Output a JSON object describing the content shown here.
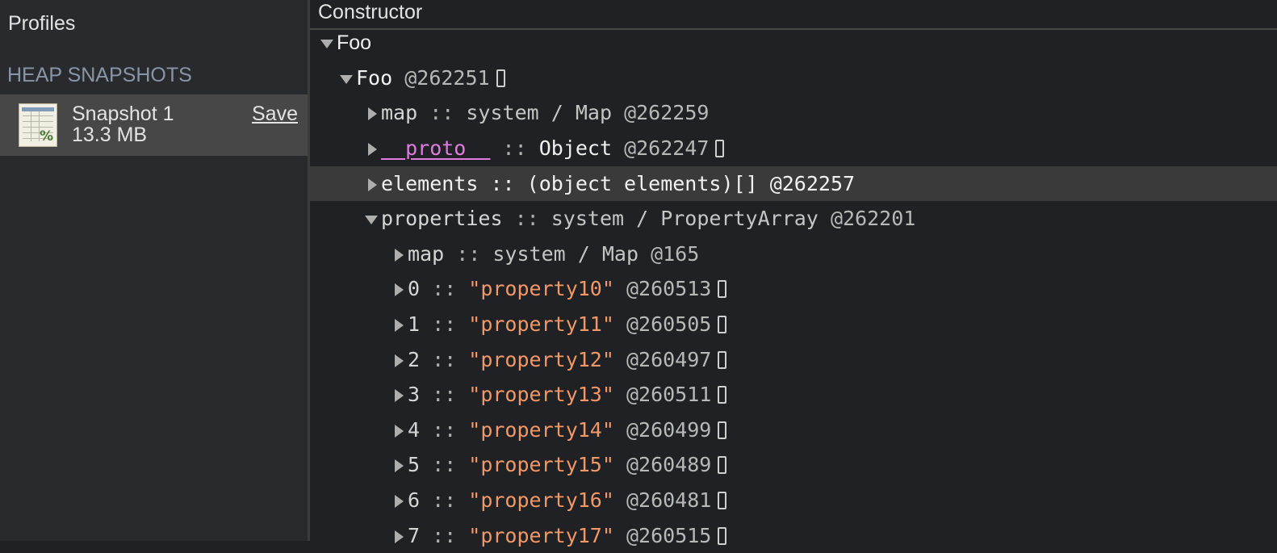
{
  "sidebar": {
    "title": "Profiles",
    "section_label": "HEAP SNAPSHOTS",
    "snapshot": {
      "name": "Snapshot 1",
      "size": "13.3 MB",
      "save_label": "Save",
      "icon": "spreadsheet-percent-icon"
    }
  },
  "main": {
    "column_header": "Constructor",
    "constructor_group": "Foo",
    "tree": {
      "root": {
        "name": "Foo",
        "id": "@262251"
      },
      "children": [
        {
          "name": "map",
          "sep": " :: ",
          "type": "system / Map",
          "id": "@262259"
        },
        {
          "name": "__proto__",
          "sep": " :: ",
          "type": "Object",
          "id": "@262247"
        },
        {
          "name": "elements",
          "sep": " :: ",
          "type": "(object elements)[]",
          "id": "@262257"
        },
        {
          "name": "properties",
          "sep": " :: ",
          "type": "system / PropertyArray",
          "id": "@262201"
        }
      ],
      "property_children": [
        {
          "name": "map",
          "sep": " :: ",
          "type": "system / Map",
          "id": "@165"
        },
        {
          "name": "0",
          "sep": " :: ",
          "value": "\"property10\"",
          "id": "@260513"
        },
        {
          "name": "1",
          "sep": " :: ",
          "value": "\"property11\"",
          "id": "@260505"
        },
        {
          "name": "2",
          "sep": " :: ",
          "value": "\"property12\"",
          "id": "@260497"
        },
        {
          "name": "3",
          "sep": " :: ",
          "value": "\"property13\"",
          "id": "@260511"
        },
        {
          "name": "4",
          "sep": " :: ",
          "value": "\"property14\"",
          "id": "@260499"
        },
        {
          "name": "5",
          "sep": " :: ",
          "value": "\"property15\"",
          "id": "@260489"
        },
        {
          "name": "6",
          "sep": " :: ",
          "value": "\"property16\"",
          "id": "@260481"
        },
        {
          "name": "7",
          "sep": " :: ",
          "value": "\"property17\"",
          "id": "@260515"
        }
      ]
    }
  },
  "colors": {
    "background": "#202124",
    "sidebar": "#292a2d",
    "selected_snapshot": "#474747",
    "selected_row": "#3a3a3a",
    "proto": "#e07be0",
    "string_value": "#f29766"
  }
}
